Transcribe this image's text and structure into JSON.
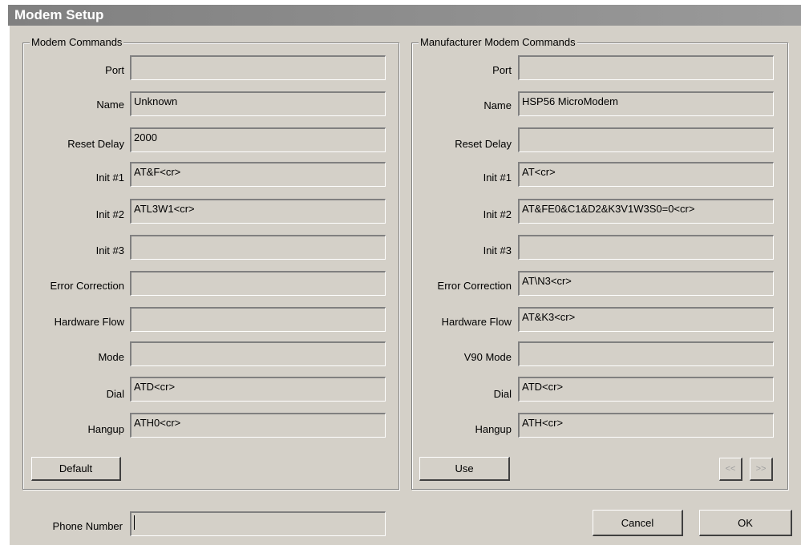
{
  "window": {
    "title": "Modem Setup"
  },
  "modem_commands": {
    "title": "Modem Commands",
    "fields": [
      {
        "label": "Port",
        "value": ""
      },
      {
        "label": "Name",
        "value": "Unknown"
      },
      {
        "label": "Reset Delay",
        "value": "2000"
      },
      {
        "label": "Init #1",
        "value": "AT&F<cr>"
      },
      {
        "label": "Init #2",
        "value": "ATL3W1<cr>"
      },
      {
        "label": "Init #3",
        "value": ""
      },
      {
        "label": "Error Correction",
        "value": ""
      },
      {
        "label": "Hardware Flow",
        "value": ""
      },
      {
        "label": "Mode",
        "value": ""
      },
      {
        "label": "Dial",
        "value": "ATD<cr>"
      },
      {
        "label": "Hangup",
        "value": "ATH0<cr>"
      }
    ],
    "default_button": "Default"
  },
  "manufacturer_commands": {
    "title": "Manufacturer Modem Commands",
    "fields": [
      {
        "label": "Port",
        "value": ""
      },
      {
        "label": "Name",
        "value": "HSP56 MicroModem"
      },
      {
        "label": "Reset Delay",
        "value": ""
      },
      {
        "label": "Init #1",
        "value": "AT<cr>"
      },
      {
        "label": "Init #2",
        "value": "AT&FE0&C1&D2&K3V1W3S0=0<cr>"
      },
      {
        "label": "Init #3",
        "value": ""
      },
      {
        "label": "Error Correction",
        "value": "AT\\N3<cr>"
      },
      {
        "label": "Hardware Flow",
        "value": "AT&K3<cr>"
      },
      {
        "label": "V90 Mode",
        "value": ""
      },
      {
        "label": "Dial",
        "value": "ATD<cr>"
      },
      {
        "label": "Hangup",
        "value": "ATH<cr>"
      }
    ],
    "use_button": "Use",
    "prev_button": "<<",
    "next_button": ">>"
  },
  "phone": {
    "label": "Phone Number",
    "value": ""
  },
  "buttons": {
    "cancel": "Cancel",
    "ok": "OK"
  }
}
